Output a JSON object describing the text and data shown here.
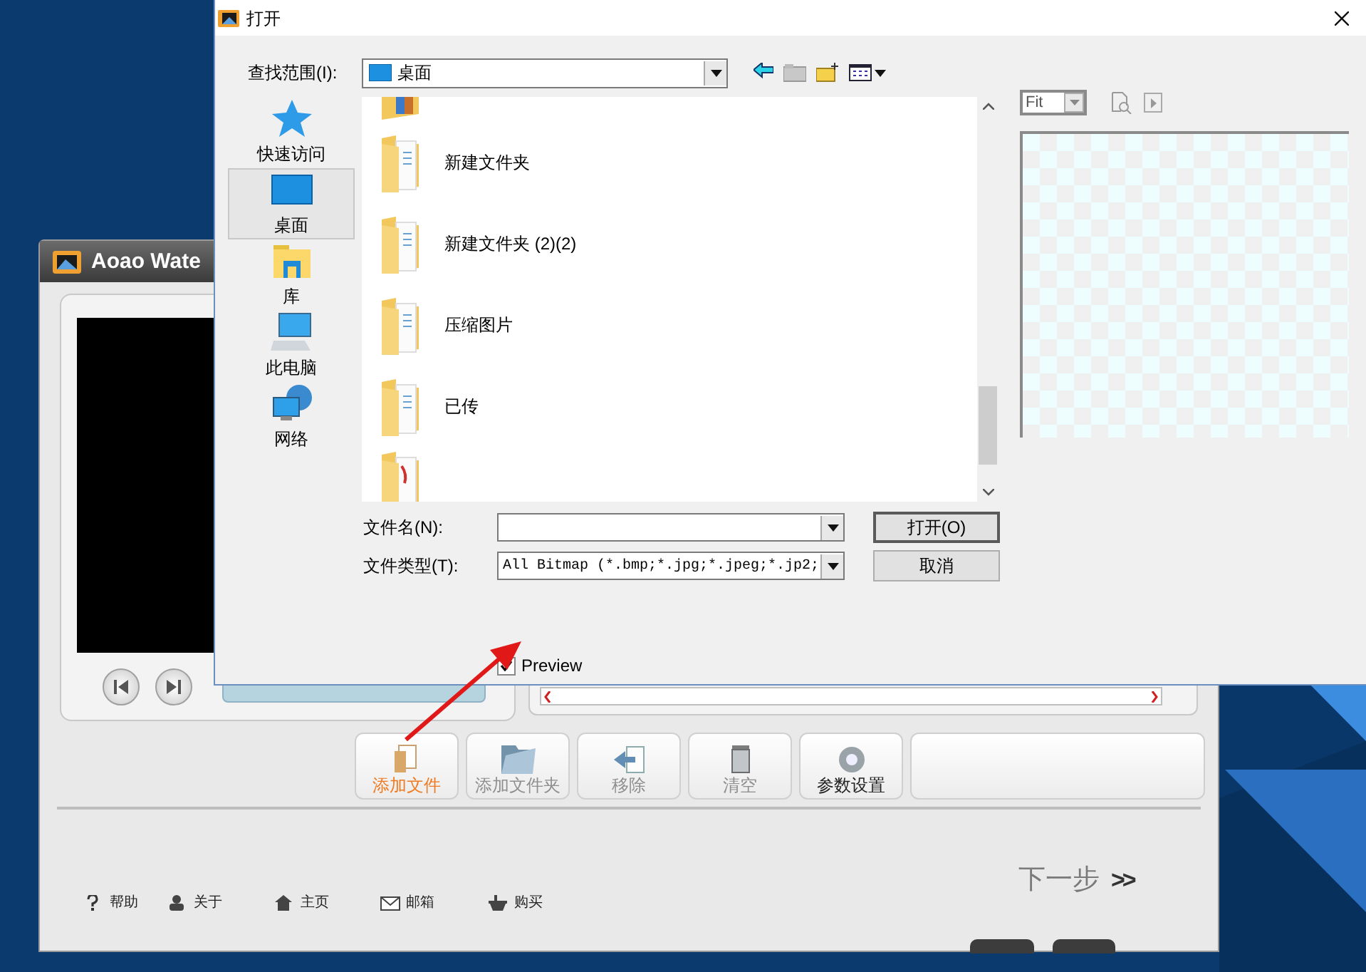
{
  "app": {
    "title": "Aoao Wate",
    "toolbar": [
      {
        "label": "添加文件",
        "selected": true,
        "disabled": false,
        "kind": "file"
      },
      {
        "label": "添加文件夹",
        "selected": false,
        "disabled": true,
        "kind": "folder"
      },
      {
        "label": "移除",
        "selected": false,
        "disabled": true,
        "kind": "remove"
      },
      {
        "label": "清空",
        "selected": false,
        "disabled": true,
        "kind": "trash"
      },
      {
        "label": "参数设置",
        "selected": false,
        "disabled": false,
        "kind": "gear"
      }
    ],
    "next": "下一步",
    "next_arrows": ">>",
    "links": [
      {
        "label": "帮助",
        "kind": "help"
      },
      {
        "label": "关于",
        "kind": "person"
      },
      {
        "label": "主页",
        "kind": "home"
      },
      {
        "label": "邮箱",
        "kind": "mail"
      },
      {
        "label": "购买",
        "kind": "basket"
      }
    ]
  },
  "dialog": {
    "title": "打开",
    "look_in_label": "查找范围(I):",
    "look_in_value": "桌面",
    "places": [
      {
        "label": "快速访问",
        "kind": "star",
        "selected": false
      },
      {
        "label": "桌面",
        "kind": "desktop",
        "selected": true
      },
      {
        "label": "库",
        "kind": "library",
        "selected": false
      },
      {
        "label": "此电脑",
        "kind": "computer",
        "selected": false
      },
      {
        "label": "网络",
        "kind": "network",
        "selected": false
      }
    ],
    "files": [
      {
        "name": "新建文件夹"
      },
      {
        "name": "新建文件夹 (2)(2)"
      },
      {
        "name": "压缩图片"
      },
      {
        "name": "已传"
      }
    ],
    "file_name_label": "文件名(N):",
    "file_type_label": "文件类型(T):",
    "file_type_value": "All Bitmap (*.bmp;*.jpg;*.jpeg;*.jp2;",
    "buttons": [
      "打开(O)",
      "取消"
    ],
    "preview": {
      "label": "Preview",
      "checked": true
    },
    "zoom_value": "Fit"
  }
}
